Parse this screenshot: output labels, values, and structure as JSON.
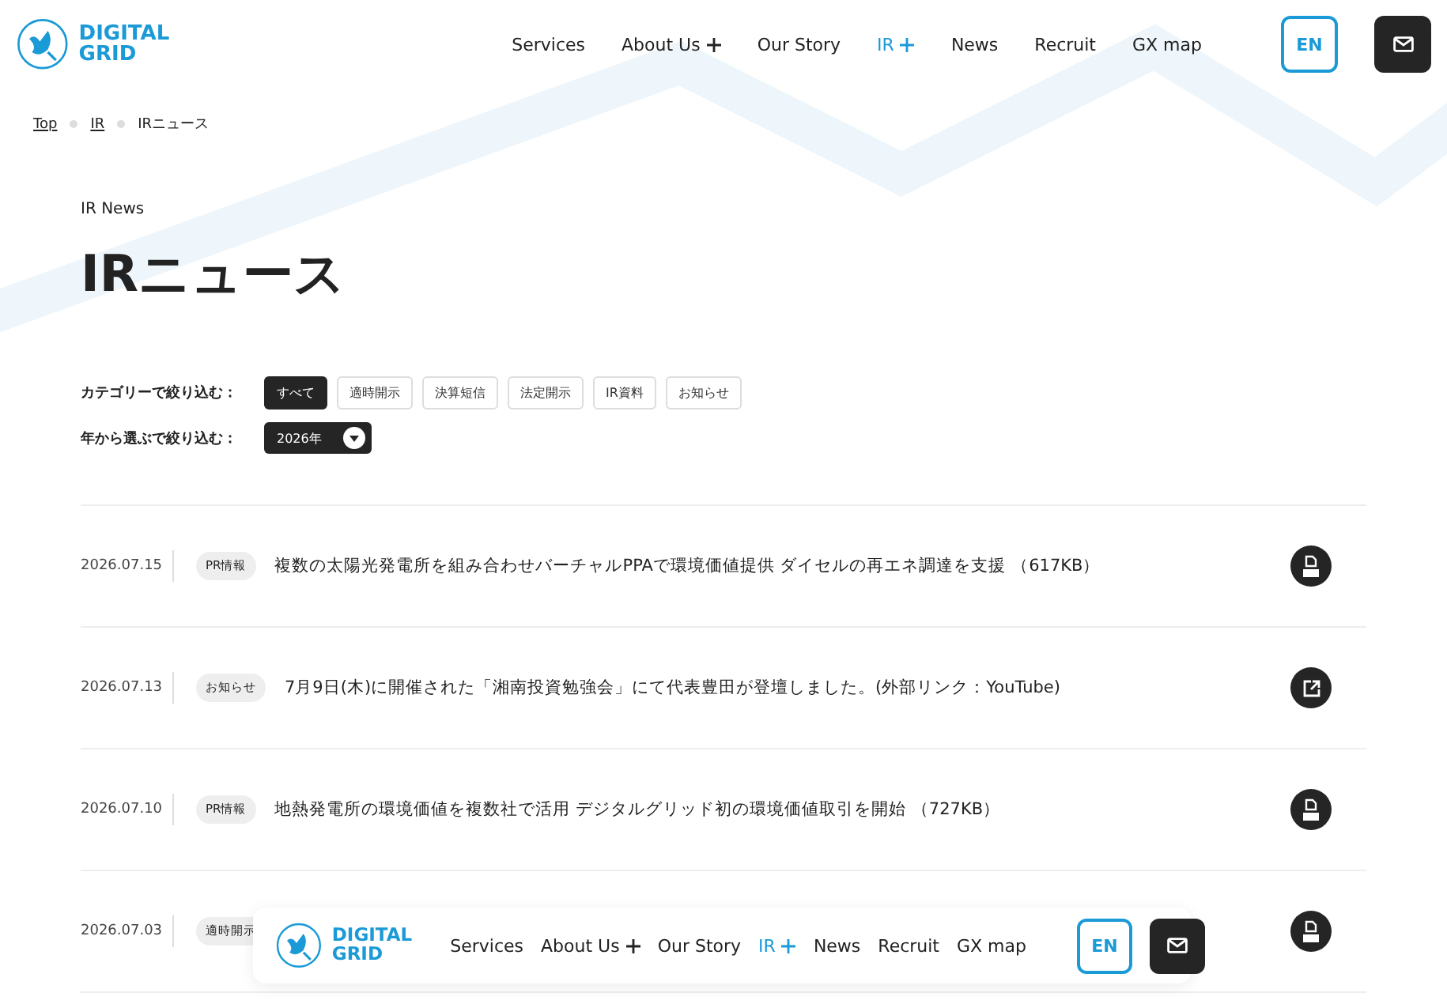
{
  "header": {
    "logo": [
      "DIGITAL",
      "GRID"
    ],
    "nav": [
      {
        "label": "Services",
        "plus": false,
        "selected": false
      },
      {
        "label": "About Us",
        "plus": true,
        "selected": false
      },
      {
        "label": "Our Story",
        "plus": false,
        "selected": false
      },
      {
        "label": "IR",
        "plus": true,
        "selected": true
      },
      {
        "label": "News",
        "plus": false,
        "selected": false
      },
      {
        "label": "Recruit",
        "plus": false,
        "selected": false
      },
      {
        "label": "GX map",
        "plus": false,
        "selected": false
      }
    ],
    "lang_button": "EN"
  },
  "breadcrumb": [
    "Top",
    "IR",
    "IRニュース"
  ],
  "page": {
    "eyebrow": "IR News",
    "title": "IRニュース"
  },
  "filters": {
    "category_label": "カテゴリーで絞り込む：",
    "categories": [
      {
        "label": "すべて",
        "selected": true
      },
      {
        "label": "適時開示",
        "selected": false
      },
      {
        "label": "決算短信",
        "selected": false
      },
      {
        "label": "法定開示",
        "selected": false
      },
      {
        "label": "IR資料",
        "selected": false
      },
      {
        "label": "お知らせ",
        "selected": false
      }
    ],
    "year_label": "年から選ぶで絞り込む：",
    "year": "2026年"
  },
  "news": [
    {
      "date": "2026.07.15",
      "tag": "PR情報",
      "title": "複数の太陽光発電所を組み合わせバーチャルPPAで環境価値提供 ダイセルの再エネ調達を支援 （617KB）",
      "kind": "pdf"
    },
    {
      "date": "2026.07.13",
      "tag": "お知らせ",
      "title": "7月9日(木)に開催された「湘南投資勉強会」にて代表豊田が登壇しました。(外部リンク：YouTube)",
      "kind": "external"
    },
    {
      "date": "2026.07.10",
      "tag": "PR情報",
      "title": "地熱発電所の環境価値を複数社で活用 デジタルグリッド初の環境価値取引を開始 （727KB）",
      "kind": "pdf"
    },
    {
      "date": "2026.07.03",
      "tag": "適時開示",
      "kind": "pdf"
    }
  ],
  "floating_nav": {
    "logo": [
      "DIGITAL",
      "GRID"
    ],
    "nav": [
      {
        "label": "Services",
        "plus": false,
        "selected": false
      },
      {
        "label": "About Us",
        "plus": true,
        "selected": false
      },
      {
        "label": "Our Story",
        "plus": false,
        "selected": false
      },
      {
        "label": "IR",
        "plus": true,
        "selected": true
      },
      {
        "label": "News",
        "plus": false,
        "selected": false
      },
      {
        "label": "Recruit",
        "plus": false,
        "selected": false
      },
      {
        "label": "GX map",
        "plus": false,
        "selected": false
      }
    ],
    "lang_button": "EN"
  }
}
